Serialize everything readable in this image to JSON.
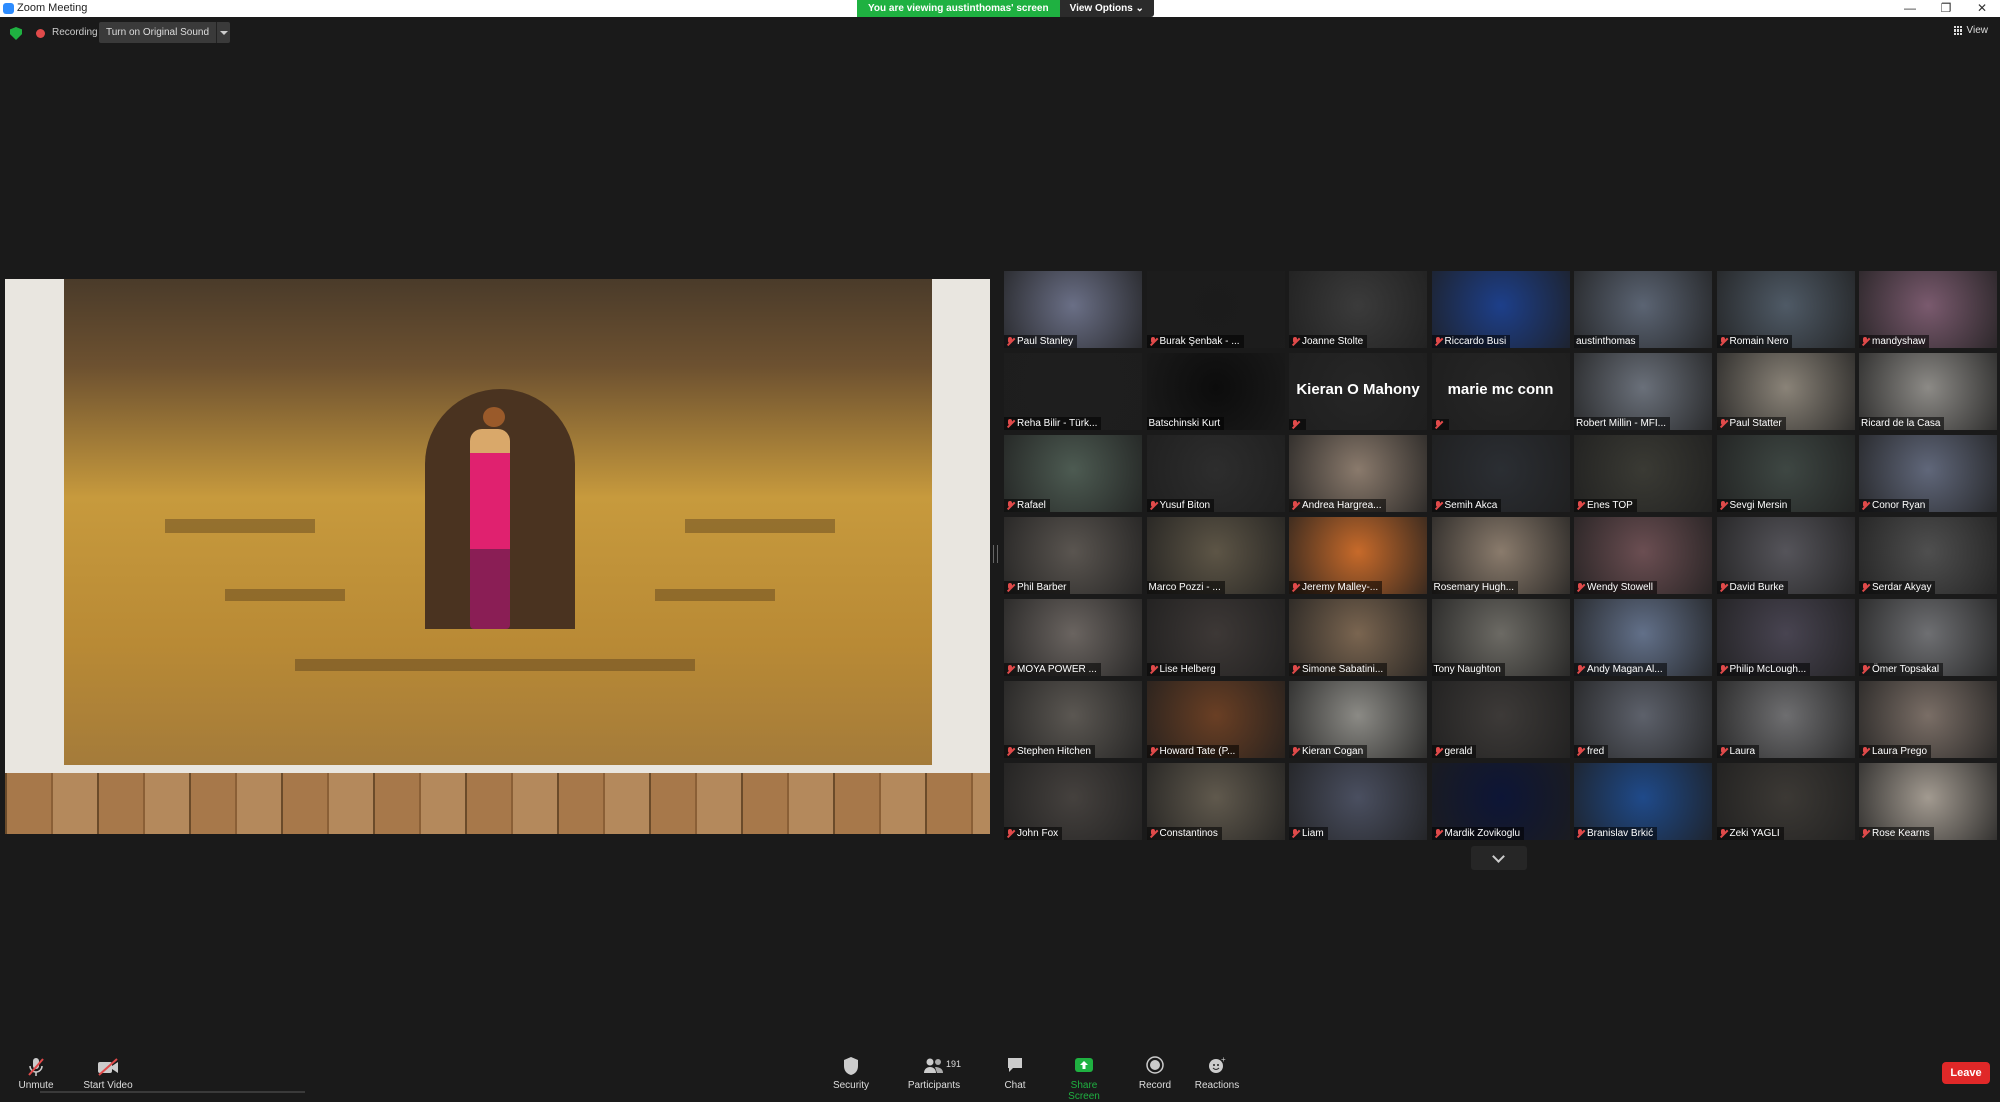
{
  "window": {
    "title": "Zoom Meeting"
  },
  "banner": {
    "viewing": "You are viewing austinthomas' screen",
    "view_options": "View Options ⌄"
  },
  "status": {
    "recording": "Recording",
    "original_sound": "Turn on Original Sound",
    "view": "View"
  },
  "participants_grid": [
    {
      "name": "Paul Stanley",
      "muted": true,
      "color": "#6a6f86"
    },
    {
      "name": "Burak Şenbak - ...",
      "muted": true,
      "color": "#1b1b1b"
    },
    {
      "name": "Joanne Stolte",
      "muted": true,
      "color": "#3b3b3b"
    },
    {
      "name": "Riccardo Busi",
      "muted": true,
      "color": "#1d3f8a"
    },
    {
      "name": "austinthomas",
      "muted": false,
      "color": "#5b6473"
    },
    {
      "name": "Romain Nero",
      "muted": true,
      "color": "#4f5a66"
    },
    {
      "name": "mandyshaw",
      "muted": true,
      "color": "#7a5a6e"
    },
    {
      "name": "Reha Bilir - Türk...",
      "muted": true,
      "color": "#1e1e1e"
    },
    {
      "name": "Batschinski Kurt",
      "muted": false,
      "color": "#0c0c0c"
    },
    {
      "name": "",
      "muted": true,
      "big_name": "Kieran O Mahony",
      "color": "#262626"
    },
    {
      "name": "",
      "muted": true,
      "big_name": "marie mc conn",
      "color": "#262626"
    },
    {
      "name": "Robert Millin - MFI...",
      "muted": false,
      "active": true,
      "color": "#6a707a"
    },
    {
      "name": "Paul Statter",
      "muted": true,
      "color": "#8a8378"
    },
    {
      "name": "Ricard de la Casa",
      "muted": false,
      "color": "#8c8a86"
    },
    {
      "name": "Rafael",
      "muted": true,
      "color": "#4d5b52"
    },
    {
      "name": "Yusuf Biton",
      "muted": true,
      "color": "#2d2d2d"
    },
    {
      "name": "Andrea Hargrea...",
      "muted": true,
      "color": "#8a7a6c"
    },
    {
      "name": "Semih Akca",
      "muted": true,
      "color": "#2b2e33"
    },
    {
      "name": "Enes TOP",
      "muted": true,
      "color": "#3a3a34"
    },
    {
      "name": "Sevgi Mersin",
      "muted": true,
      "color": "#3e4743"
    },
    {
      "name": "Conor Ryan",
      "muted": true,
      "color": "#60677a"
    },
    {
      "name": "Phil Barber",
      "muted": true,
      "color": "#5a5550"
    },
    {
      "name": "Marco Pozzi - ...",
      "muted": false,
      "color": "#5d5546"
    },
    {
      "name": "Jeremy Malley-...",
      "muted": true,
      "color": "#c76a2a"
    },
    {
      "name": "Rosemary Hugh...",
      "muted": false,
      "color": "#8a7b6c"
    },
    {
      "name": "Wendy Stowell",
      "muted": true,
      "color": "#6b4e52"
    },
    {
      "name": "David Burke",
      "muted": true,
      "color": "#55545a"
    },
    {
      "name": "Serdar Akyay",
      "muted": true,
      "color": "#4f4f4f"
    },
    {
      "name": "MOYA POWER ...",
      "muted": true,
      "color": "#6a6460"
    },
    {
      "name": "Lise Helberg",
      "muted": true,
      "color": "#3d3836"
    },
    {
      "name": "Simone Sabatini...",
      "muted": true,
      "color": "#7a6550"
    },
    {
      "name": "Tony Naughton",
      "muted": false,
      "color": "#6c6a64"
    },
    {
      "name": "Andy Magan Al...",
      "muted": true,
      "color": "#627089"
    },
    {
      "name": "Philip McLough...",
      "muted": true,
      "color": "#484451"
    },
    {
      "name": "Ömer Topsakal",
      "muted": true,
      "color": "#6e6f72"
    },
    {
      "name": "Stephen Hitchen",
      "muted": true,
      "color": "#5b5752"
    },
    {
      "name": "Howard Tate (P...",
      "muted": true,
      "color": "#6a3f24"
    },
    {
      "name": "Kieran Cogan",
      "muted": true,
      "color": "#8b8a85"
    },
    {
      "name": "gerald",
      "muted": true,
      "color": "#3d3a38"
    },
    {
      "name": "fred",
      "muted": true,
      "color": "#5d616b"
    },
    {
      "name": "Laura",
      "muted": true,
      "color": "#6e6e70"
    },
    {
      "name": "Laura Prego",
      "muted": true,
      "color": "#7a6e66"
    },
    {
      "name": "John Fox",
      "muted": true,
      "color": "#45413e"
    },
    {
      "name": "Constantinos",
      "muted": true,
      "color": "#60594d"
    },
    {
      "name": "Liam",
      "muted": true,
      "color": "#4a4f60"
    },
    {
      "name": "Mardik Zovikoglu",
      "muted": true,
      "color": "#0d1536"
    },
    {
      "name": "Branislav Brkić",
      "muted": true,
      "color": "#1f4a8a"
    },
    {
      "name": "Zeki YAGLI",
      "muted": true,
      "color": "#3c3935"
    },
    {
      "name": "Rose Kearns",
      "muted": true,
      "color": "#a29a90"
    }
  ],
  "toolbar": {
    "unmute": "Unmute",
    "start_video": "Start Video",
    "security": "Security",
    "participants": "Participants",
    "participants_count": "191",
    "chat": "Chat",
    "share_screen": "Share Screen",
    "record": "Record",
    "reactions": "Reactions",
    "leave": "Leave"
  }
}
